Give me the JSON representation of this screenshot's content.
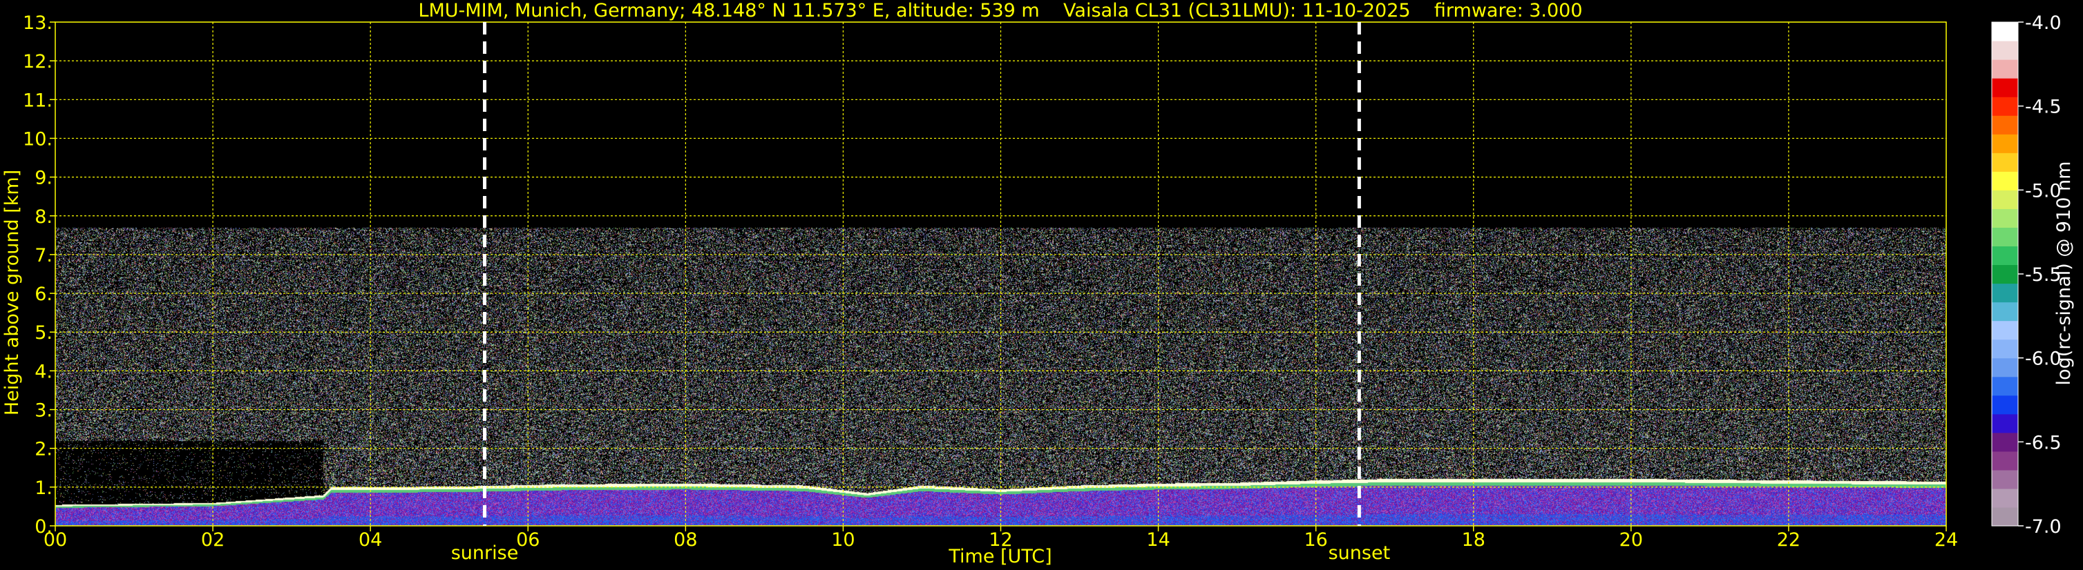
{
  "title": "LMU-MIM, Munich, Germany; 48.148° N 11.573° E, altitude: 539 m    Vaisala CL31 (CL31LMU): 11-10-2025    firmware: 3.000",
  "colors": {
    "axis_text": "#ffff00",
    "grid": "#ffff00",
    "background": "#000000",
    "marker": "#ffffff"
  },
  "chart_data": {
    "type": "heatmap",
    "xlabel": "Time [UTC]",
    "ylabel": "Height above ground [km]",
    "xlim": [
      0,
      24
    ],
    "ylim": [
      0,
      13
    ],
    "x_ticks": [
      "00",
      "02",
      "04",
      "06",
      "08",
      "10",
      "12",
      "14",
      "16",
      "18",
      "20",
      "22",
      "24"
    ],
    "y_ticks": [
      "0.",
      "1.",
      "2.",
      "3.",
      "4.",
      "5.",
      "6.",
      "7.",
      "8.",
      "9.",
      "10.",
      "11.",
      "12.",
      "13."
    ],
    "grid": true,
    "annotations": [
      {
        "label": "sunrise",
        "x": 5.45
      },
      {
        "label": "sunset",
        "x": 16.55
      }
    ],
    "colorbar": {
      "label": "log(rc-signal) @ 910 nm",
      "range": [
        -7.0,
        -4.0
      ],
      "ticks": [
        "-4.0",
        "-4.5",
        "-5.0",
        "-5.5",
        "-6.0",
        "-6.5",
        "-7.0"
      ],
      "colors": [
        "#a896a8",
        "#b49bb4",
        "#a070a0",
        "#8a3c8a",
        "#6a1a80",
        "#3010d0",
        "#1040f0",
        "#3070f0",
        "#6a9cf0",
        "#8ab4f8",
        "#a8c8ff",
        "#58b8d8",
        "#20a0a0",
        "#10a040",
        "#30c060",
        "#70d870",
        "#a8e870",
        "#d8f060",
        "#ffff40",
        "#ffd020",
        "#ffa000",
        "#ff6a00",
        "#ff2a00",
        "#e80000",
        "#f0b0b0",
        "#f0d8d8",
        "#ffffff"
      ]
    },
    "cloud_base_height_km": [
      [
        0,
        0.55
      ],
      [
        2,
        0.6
      ],
      [
        3.4,
        0.8
      ],
      [
        3.5,
        1.0
      ],
      [
        5,
        1.02
      ],
      [
        6.5,
        1.08
      ],
      [
        8,
        1.1
      ],
      [
        9.5,
        1.05
      ],
      [
        10.3,
        0.85
      ],
      [
        11,
        1.05
      ],
      [
        12,
        0.95
      ],
      [
        13,
        1.05
      ],
      [
        14,
        1.1
      ],
      [
        15,
        1.12
      ],
      [
        16,
        1.18
      ],
      [
        17,
        1.22
      ],
      [
        18,
        1.22
      ],
      [
        20,
        1.22
      ],
      [
        22,
        1.18
      ],
      [
        24,
        1.15
      ]
    ],
    "noise_top_km": 7.7
  }
}
